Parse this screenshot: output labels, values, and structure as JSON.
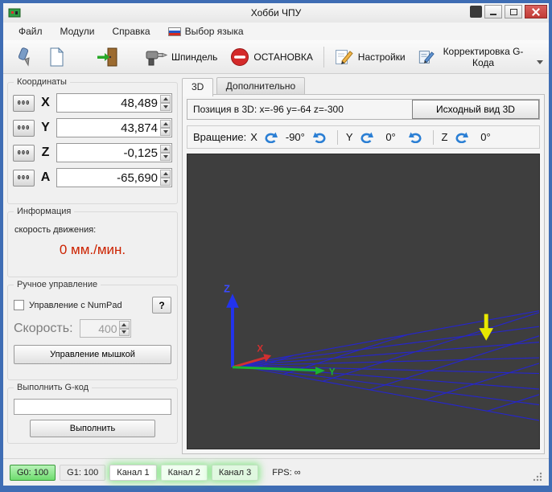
{
  "window": {
    "title": "Хобби ЧПУ"
  },
  "menu": {
    "items": [
      "Файл",
      "Модули",
      "Справка"
    ],
    "language_label": "Выбор языка"
  },
  "toolbar": {
    "spindle": "Шпиндель",
    "stop": "ОСТАНОВКА",
    "settings": "Настройки",
    "gcode": "Корректировка G-Кода"
  },
  "coordinates": {
    "title": "Координаты",
    "zero": "000",
    "axes": [
      {
        "label": "X",
        "value": "48,489"
      },
      {
        "label": "Y",
        "value": "43,874"
      },
      {
        "label": "Z",
        "value": "-0,125"
      },
      {
        "label": "A",
        "value": "-65,690"
      }
    ]
  },
  "info": {
    "title": "Информация",
    "speed_label": "скорость движения:",
    "speed_value": "0 мм./мин."
  },
  "manual": {
    "title": "Ручное управление",
    "numpad": "Управление с NumPad",
    "help": "?",
    "speed_label": "Скорость:",
    "speed_value": "400",
    "mouse": "Управление мышкой"
  },
  "gcode": {
    "title": "Выполнить G-код",
    "input_value": "",
    "execute": "Выполнить"
  },
  "view3d": {
    "tabs": [
      "3D",
      "Дополнительно"
    ],
    "position": "Позиция в 3D: x=-96 y=-64 z=-300",
    "reset": "Исходный вид 3D",
    "rotation_label": "Вращение:",
    "rotation": [
      {
        "axis": "X",
        "value": "-90°"
      },
      {
        "axis": "Y",
        "value": "0°"
      },
      {
        "axis": "Z",
        "value": "0°"
      }
    ],
    "axis_x": "X",
    "axis_y": "Y",
    "axis_z": "Z"
  },
  "statusbar": {
    "g0": "G0: 100",
    "g1": "G1: 100",
    "channels": [
      "Канал 1",
      "Канал 2",
      "Канал 3"
    ],
    "fps": "FPS: ∞"
  },
  "colors": {
    "window_border": "#3f6db4",
    "speed_value": "#cc2200",
    "stop_icon": "#d42a2a",
    "g0_badge": "#90ee90",
    "grid": "#2626c9",
    "axis_x": "#d03030",
    "axis_y": "#19b530",
    "axis_z": "#2233ee",
    "tool_marker": "#e8e800"
  }
}
